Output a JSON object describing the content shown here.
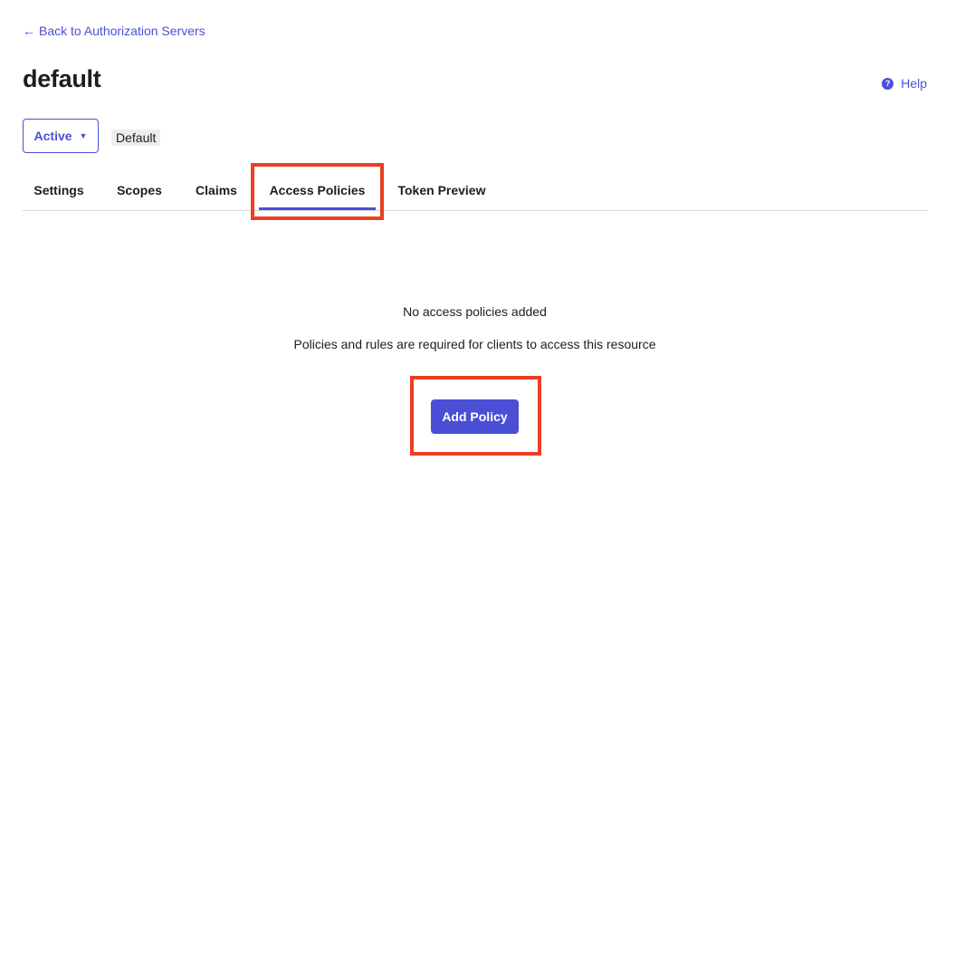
{
  "nav": {
    "back_arrow": "←",
    "back_label": "Back to Authorization Servers"
  },
  "header": {
    "title": "default",
    "help_label": "Help",
    "help_icon": "?"
  },
  "status": {
    "selected": "Active",
    "caret": "▼",
    "badge": "Default"
  },
  "tabs": [
    {
      "label": "Settings",
      "active": false
    },
    {
      "label": "Scopes",
      "active": false
    },
    {
      "label": "Claims",
      "active": false
    },
    {
      "label": "Access Policies",
      "active": true
    },
    {
      "label": "Token Preview",
      "active": false
    }
  ],
  "empty_state": {
    "title": "No access policies added",
    "subtitle": "Policies and rules are required for clients to access this resource",
    "button_label": "Add Policy"
  },
  "colors": {
    "accent": "#4b4fd6",
    "highlight": "#ea3f22"
  }
}
